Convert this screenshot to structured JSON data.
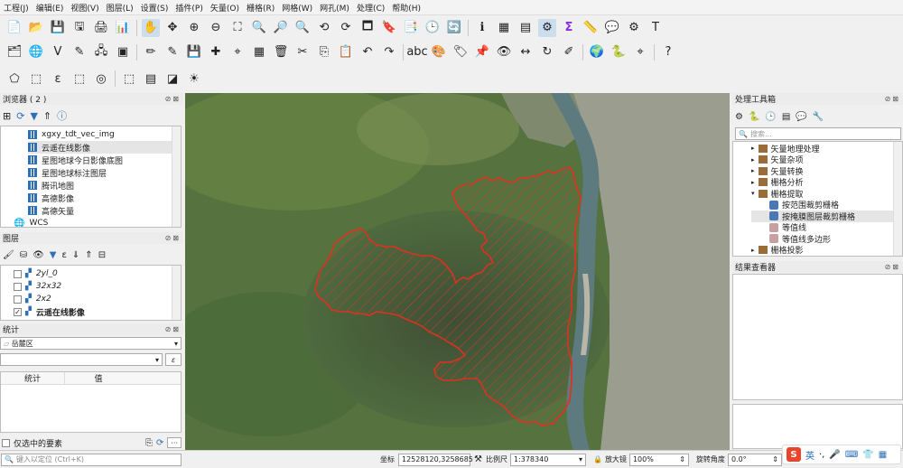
{
  "menu": [
    "工程(J)",
    "编辑(E)",
    "视图(V)",
    "图层(L)",
    "设置(S)",
    "插件(P)",
    "矢量(O)",
    "栅格(R)",
    "网格(W)",
    "网孔(M)",
    "处理(C)",
    "帮助(H)"
  ],
  "browser": {
    "title": "浏览器 ( 2 )",
    "items": [
      "xgxy_tdt_vec_img",
      "云遥在线影像",
      "星图地球今日影像底图",
      "星图地球标注图层",
      "腾讯地图",
      "高德影像",
      "高德矢量"
    ],
    "wcs_label": "WCS"
  },
  "layers": {
    "title": "图层",
    "items": [
      {
        "name": "2yl_0",
        "checked": ""
      },
      {
        "name": "32x32",
        "checked": ""
      },
      {
        "name": "2x2",
        "checked": ""
      },
      {
        "name": "云遥在线影像",
        "checked": "✓"
      }
    ]
  },
  "stats": {
    "title": "统计",
    "layer": "岳麓区",
    "col_stat": "统计",
    "col_value": "值",
    "epsilon": "ε",
    "selected_only": "仅选中的要素",
    "more": "···"
  },
  "processing": {
    "title": "处理工具箱",
    "search_placeholder": "搜索...",
    "tree": [
      "矢量地理处理",
      "矢量杂项",
      "矢量转换",
      "栅格分析",
      "栅格提取",
      "按范围裁剪栅格",
      "按掩膜图层裁剪栅格",
      "等值线",
      "等值线多边形",
      "栅格投影"
    ]
  },
  "results": {
    "title": "结果查看器"
  },
  "status": {
    "locate_placeholder": "键入以定位 (Ctrl+K)",
    "coord_label": "坐标",
    "coord_value": "12528120,3258685",
    "scale_label": "比例尺",
    "scale_value": "1:378340",
    "magnifier_label": "放大镜",
    "magnifier_value": "100%",
    "rotation_label": "旋转角度",
    "rotation_value": "0.0°"
  },
  "ime": {
    "lang": "英"
  },
  "colors": {
    "polygon_stroke": "#e03020",
    "water": "#5d7a7e",
    "urban": "#a6a39a"
  }
}
